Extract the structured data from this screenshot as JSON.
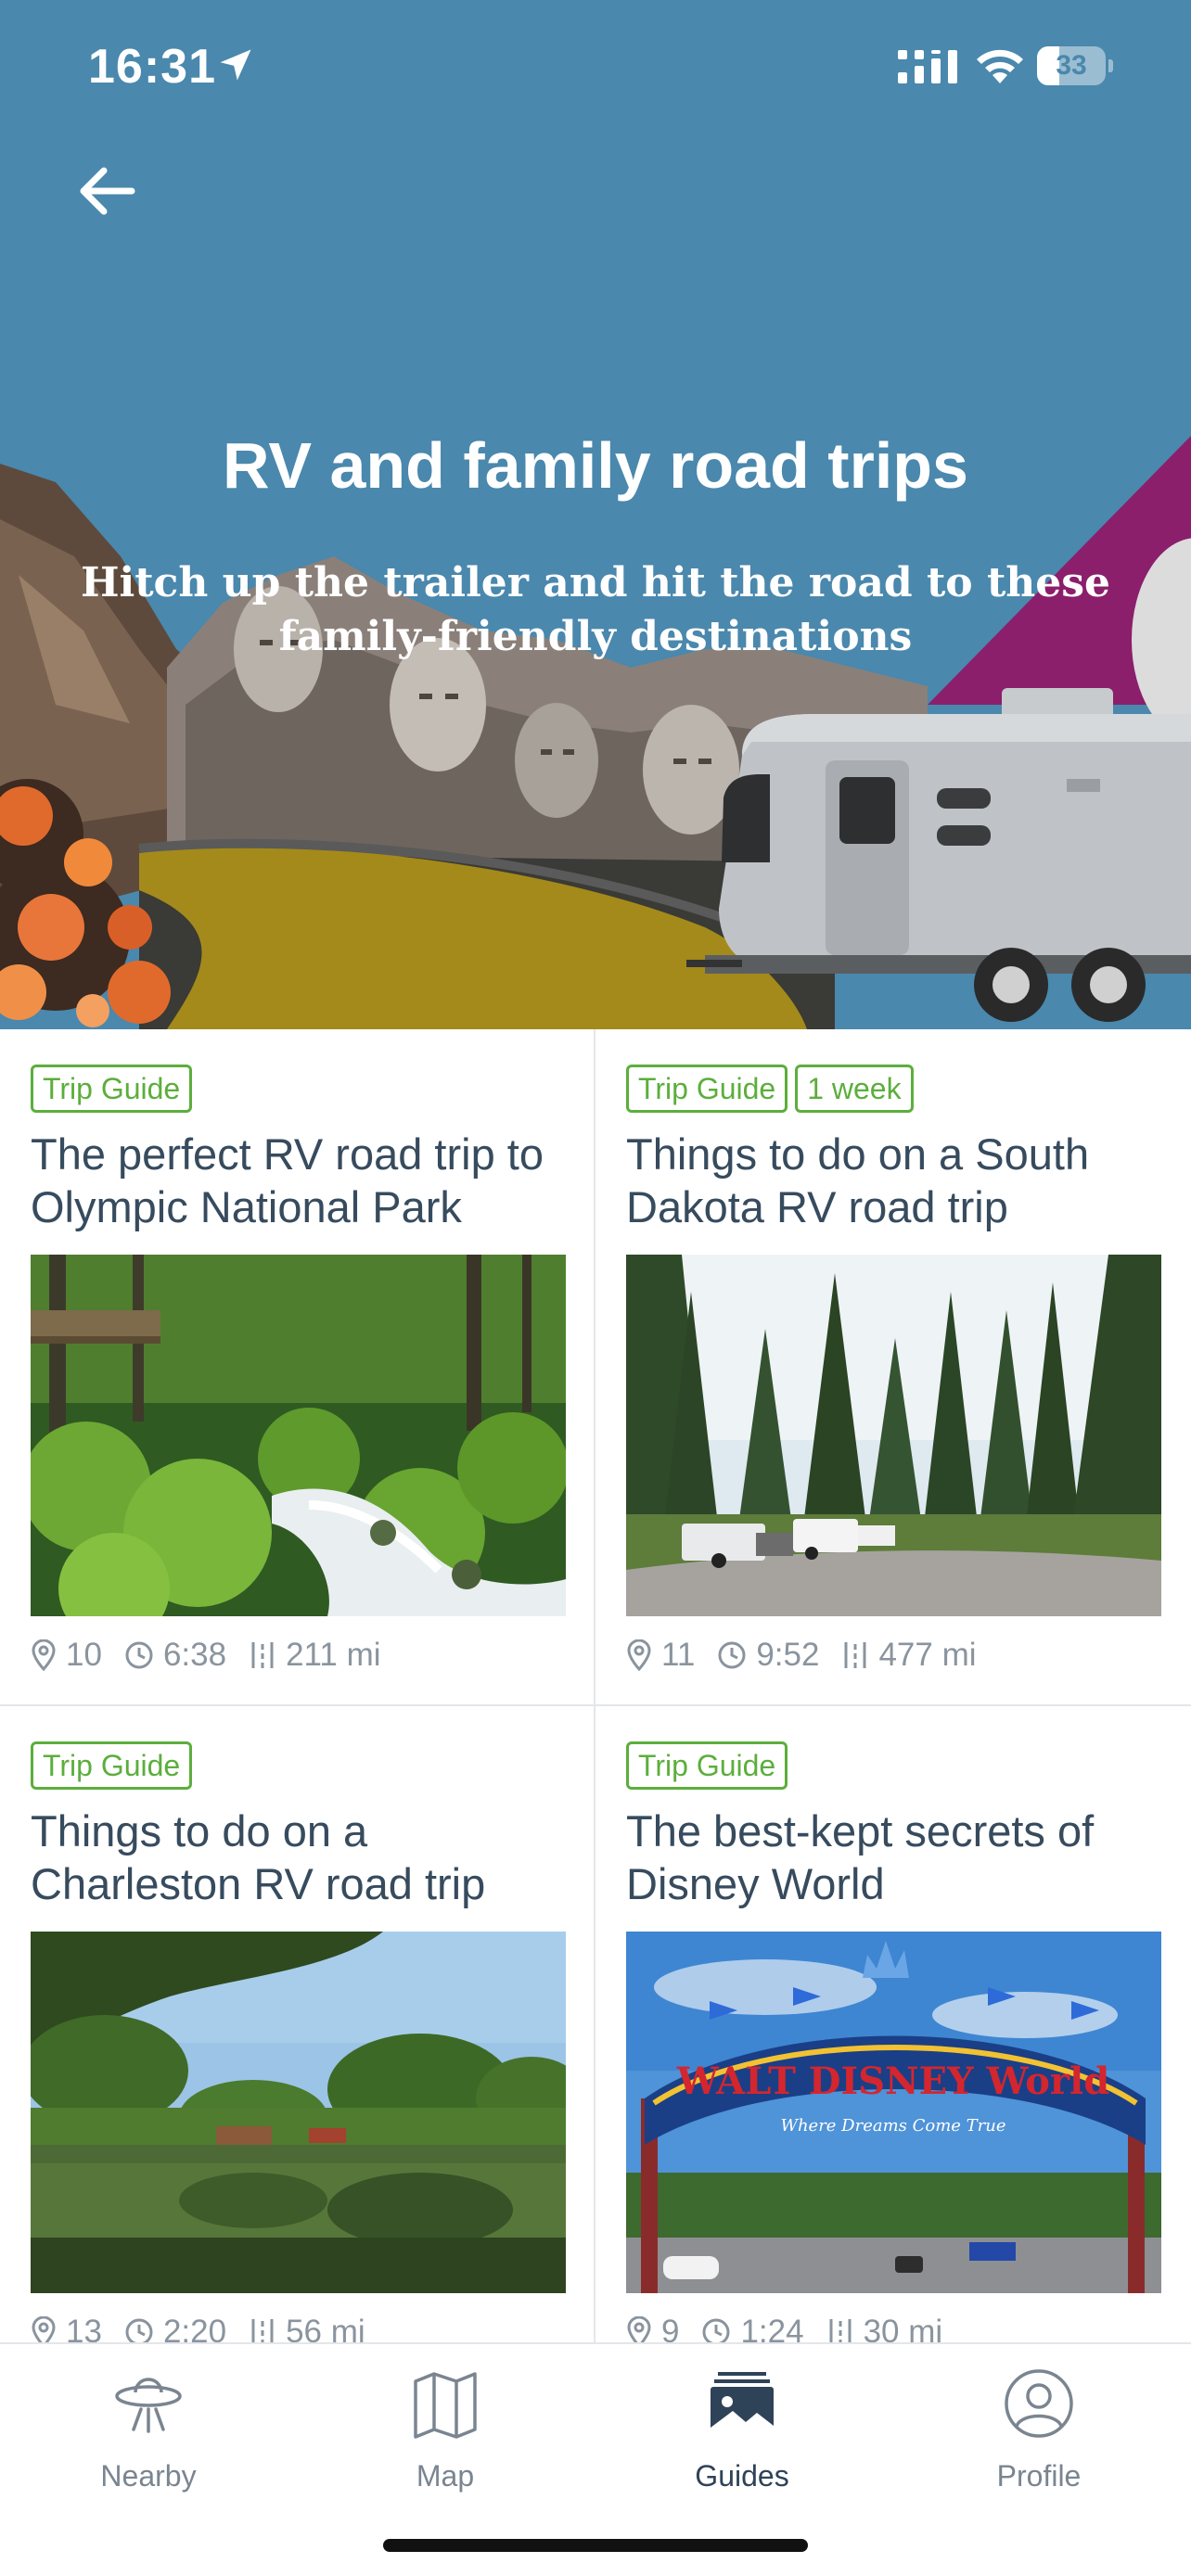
{
  "status_bar": {
    "time": "16:31",
    "battery": "33",
    "battery_level": 0.33
  },
  "hero": {
    "title": "RV and family road trips",
    "subtitle": "Hitch up the trailer and hit the road to these family-friendly destinations"
  },
  "cards": [
    {
      "tags": [
        "Trip Guide"
      ],
      "title": "The perfect RV road trip to Olympic National Park",
      "stops": "10",
      "duration": "6:38",
      "distance": "211 mi",
      "image": "mossy-forest-creek"
    },
    {
      "tags": [
        "Trip Guide",
        "1 week"
      ],
      "title": "Things to do on a South Dakota RV road trip",
      "stops": "11",
      "duration": "9:52",
      "distance": "477 mi",
      "image": "pine-campground"
    },
    {
      "tags": [
        "Trip Guide"
      ],
      "title": "Things to do on a Charleston RV road trip",
      "stops": "13",
      "duration": "2:20",
      "distance": "56 mi",
      "image": "lake-reflection"
    },
    {
      "tags": [
        "Trip Guide"
      ],
      "title": "The best-kept secrets of Disney World",
      "stops": "9",
      "duration": "1:24",
      "distance": "30 mi",
      "image": "disney-gate"
    }
  ],
  "disney_sign": {
    "main": "WALT DISNEY World",
    "tagline": "Where Dreams Come True"
  },
  "tabs": [
    {
      "label": "Nearby",
      "icon": "ufo-icon",
      "active": false
    },
    {
      "label": "Map",
      "icon": "map-icon",
      "active": false
    },
    {
      "label": "Guides",
      "icon": "guides-icon",
      "active": true
    },
    {
      "label": "Profile",
      "icon": "profile-icon",
      "active": false
    }
  ],
  "colors": {
    "hero_bg": "#4a88ad",
    "tag_green": "#5cae3c",
    "title_text": "#374b5e",
    "meta_text": "#8a949e",
    "active_tab": "#2f4358"
  }
}
